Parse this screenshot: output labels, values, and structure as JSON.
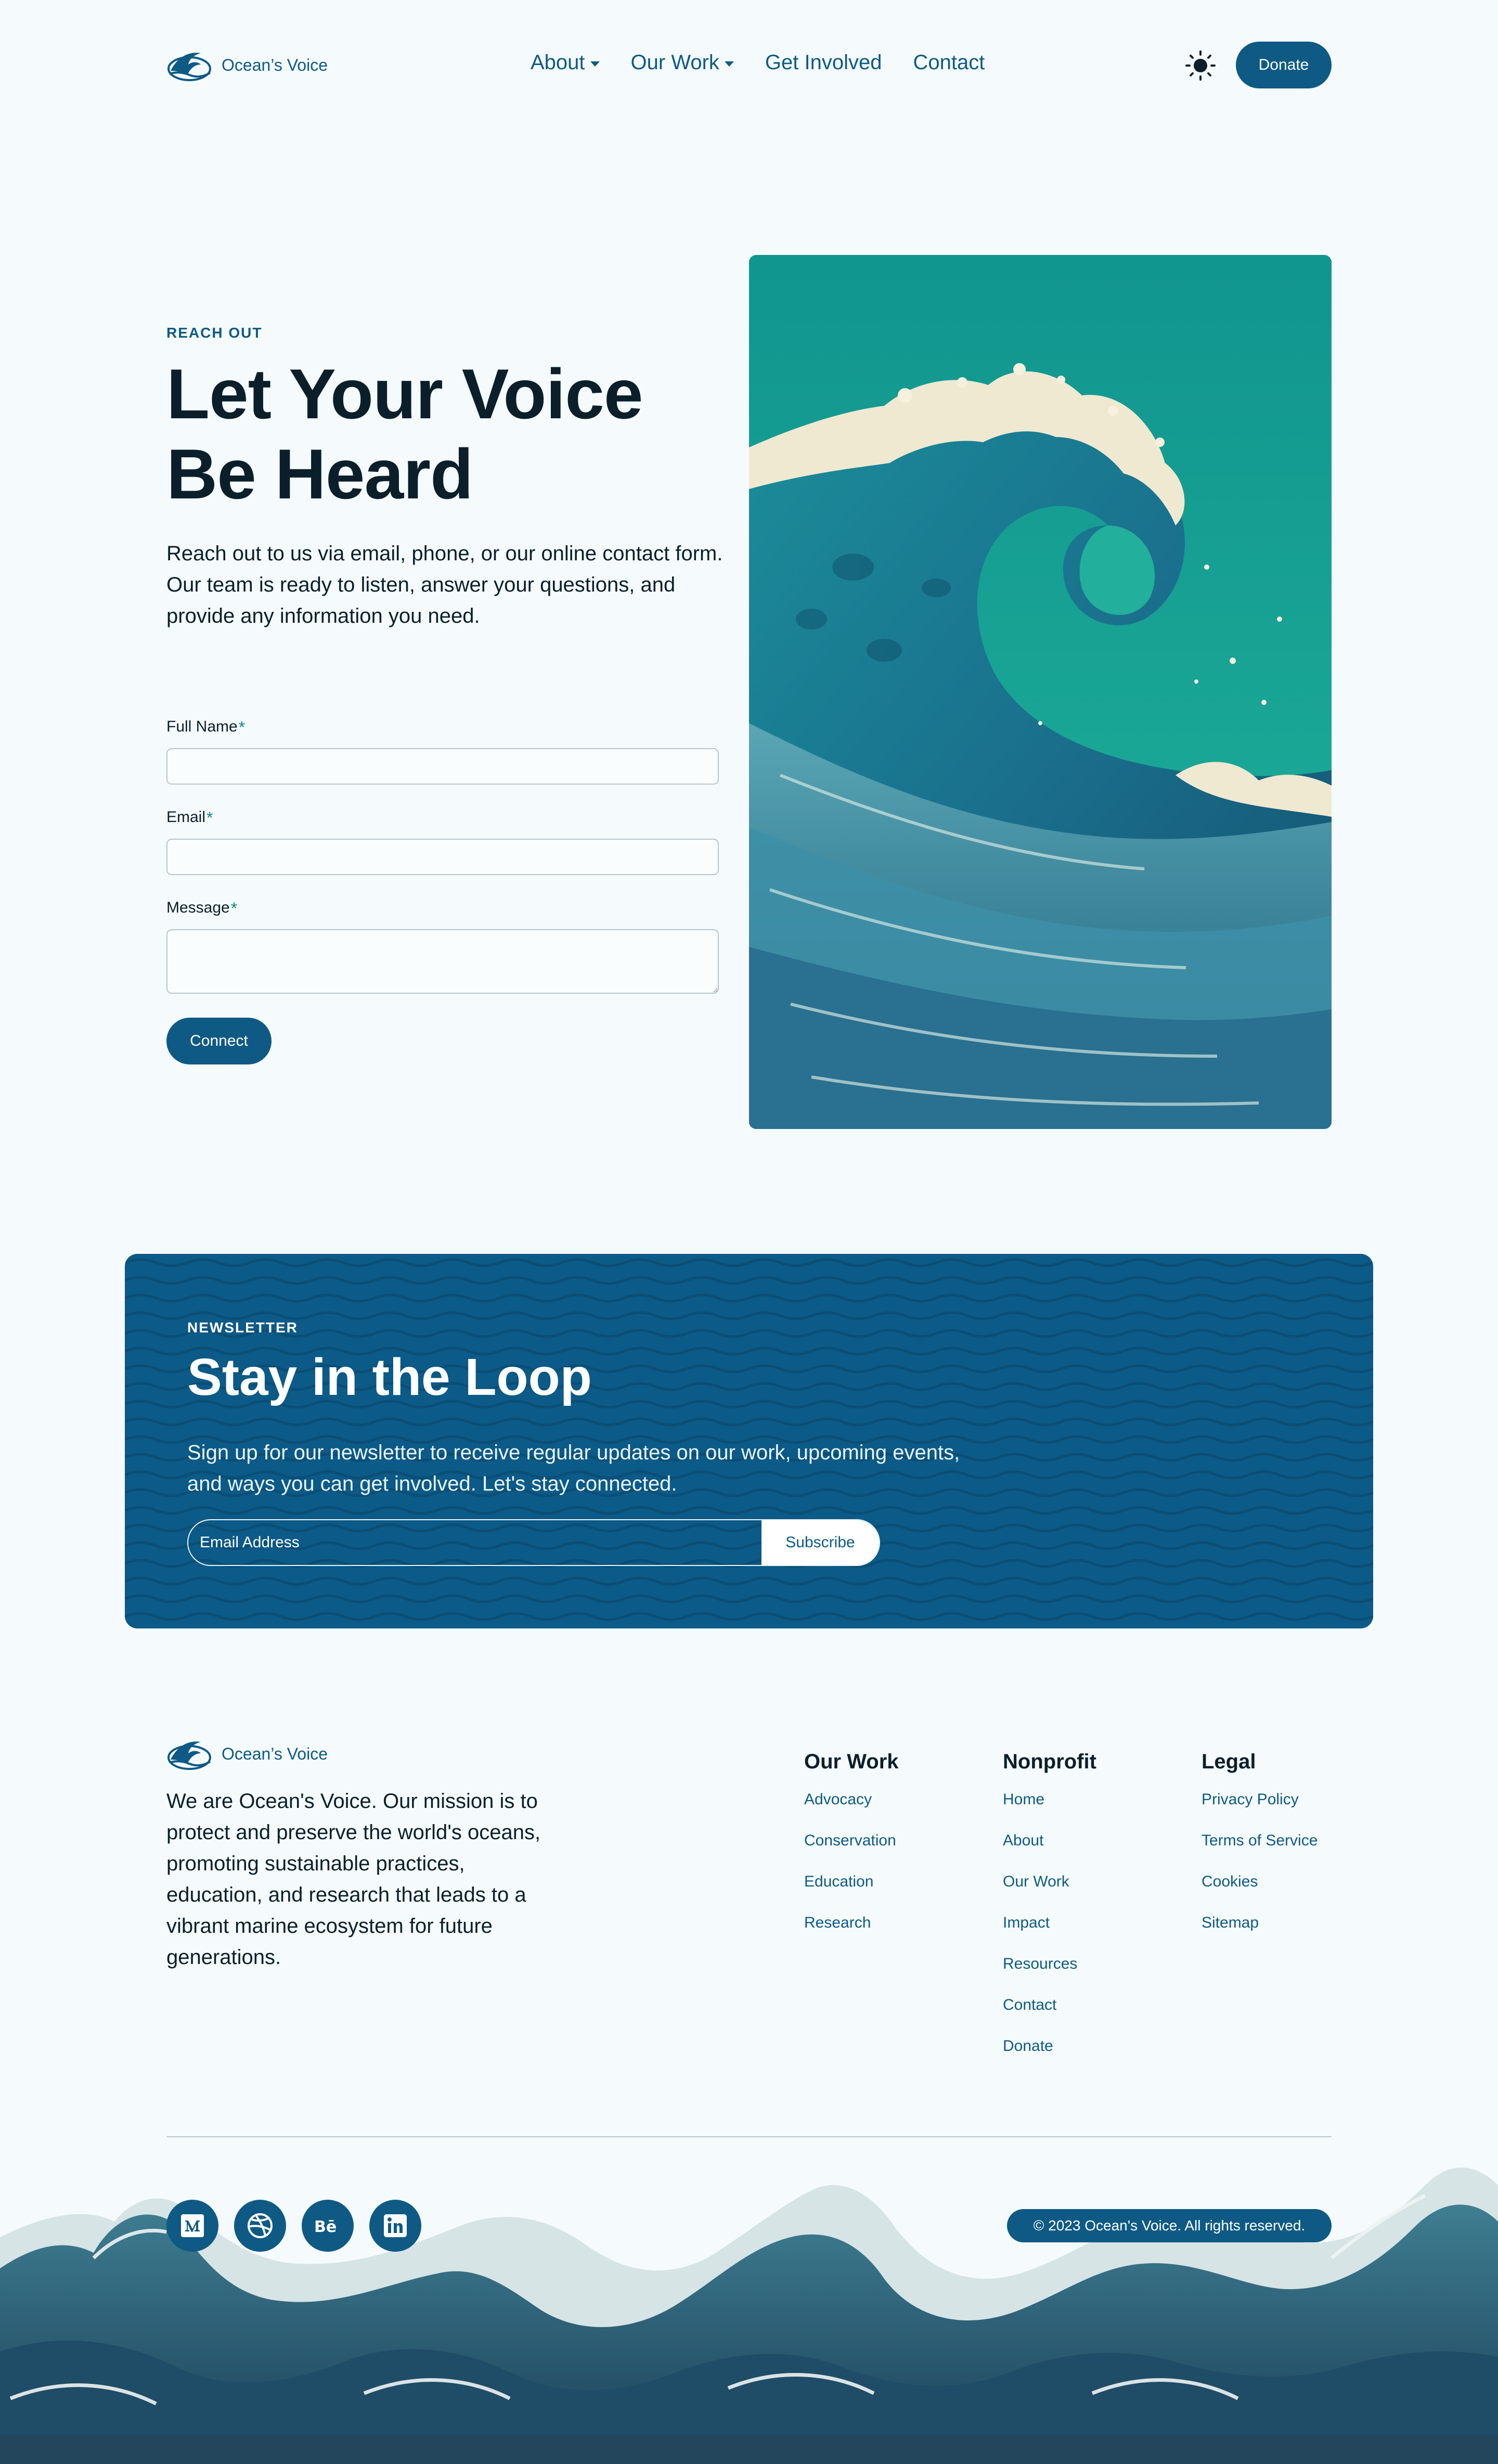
{
  "brand": {
    "name": "Ocean’s Voice",
    "accent": "#0e5a84",
    "teal": "#0e8a7e",
    "background": "#f5fbfd"
  },
  "header": {
    "nav": [
      {
        "label": "About",
        "dropdown": true
      },
      {
        "label": "Our Work",
        "dropdown": true
      },
      {
        "label": "Get Involved",
        "dropdown": false
      },
      {
        "label": "Contact",
        "dropdown": false
      }
    ],
    "theme_icon": "sun-icon",
    "donate_label": "Donate"
  },
  "hero": {
    "eyebrow": "REACH OUT",
    "title": "Let Your Voice Be Heard",
    "description": "Reach out to us via email, phone, or our online contact form. Our team is ready to listen, answer your questions, and provide any information you need.",
    "form": {
      "full_name_label": "Full Name",
      "email_label": "Email",
      "message_label": "Message",
      "required_mark": "*",
      "full_name_value": "",
      "email_value": "",
      "message_value": "",
      "submit_label": "Connect"
    },
    "image_alt_icon": "ocean-wave-illustration"
  },
  "newsletter": {
    "eyebrow": "NEWSLETTER",
    "title": "Stay in the Loop",
    "description": "Sign up for our newsletter to receive regular updates on our work, upcoming events, and ways you can get involved. Let's stay connected.",
    "email_placeholder": "Email Address",
    "submit_label": "Subscribe"
  },
  "footer": {
    "about": "We are Ocean's Voice. Our mission is to protect and preserve the world's oceans, promoting sustainable practices, education, and research that leads to a vibrant marine ecosystem for future generations.",
    "columns": [
      {
        "title": "Our Work",
        "links": [
          "Advocacy",
          "Conservation",
          "Education",
          "Research"
        ]
      },
      {
        "title": "Nonprofit",
        "links": [
          "Home",
          "About",
          "Our Work",
          "Impact",
          "Resources",
          "Contact",
          "Donate"
        ]
      },
      {
        "title": "Legal",
        "links": [
          "Privacy Policy",
          "Terms of Service",
          "Cookies",
          "Sitemap"
        ]
      }
    ],
    "social": [
      "medium-icon",
      "dribbble-icon",
      "behance-icon",
      "linkedin-icon"
    ],
    "copyright": "© 2023 Ocean's Voice. All rights reserved."
  }
}
